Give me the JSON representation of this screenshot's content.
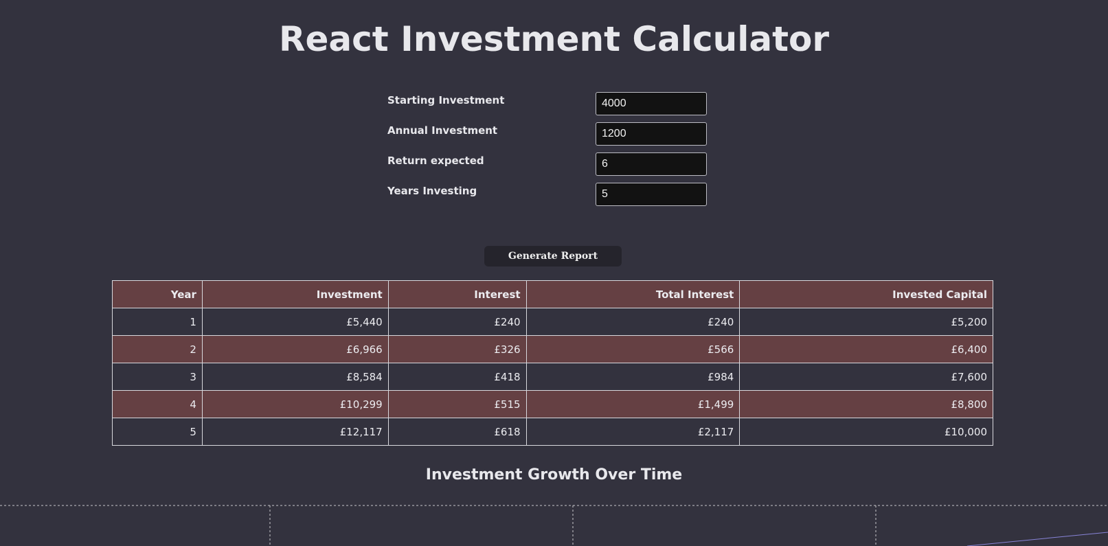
{
  "page": {
    "title": "React Investment Calculator"
  },
  "form": {
    "fields": [
      {
        "label": "Starting Investment",
        "value": "4000"
      },
      {
        "label": "Annual Investment",
        "value": "1200"
      },
      {
        "label": "Return expected",
        "value": "6"
      },
      {
        "label": "Years Investing",
        "value": "5"
      }
    ],
    "generate_label": "Generate Report"
  },
  "table": {
    "headers": [
      "Year",
      "Investment",
      "Interest",
      "Total Interest",
      "Invested Capital"
    ],
    "rows": [
      [
        "1",
        "£5,440",
        "£240",
        "£240",
        "£5,200"
      ],
      [
        "2",
        "£6,966",
        "£326",
        "£566",
        "£6,400"
      ],
      [
        "3",
        "£8,584",
        "£418",
        "£984",
        "£7,600"
      ],
      [
        "4",
        "£10,299",
        "£515",
        "£1,499",
        "£8,800"
      ],
      [
        "5",
        "£12,117",
        "£618",
        "£2,117",
        "£10,000"
      ]
    ]
  },
  "chart": {
    "title": "Investment Growth Over Time",
    "grid_color": "#c8c8cc",
    "line_color": "#8884d8"
  },
  "colors": {
    "background": "#33323e",
    "row_accent": "#654043",
    "input_bg": "#121212",
    "button_bg": "#25242c"
  }
}
